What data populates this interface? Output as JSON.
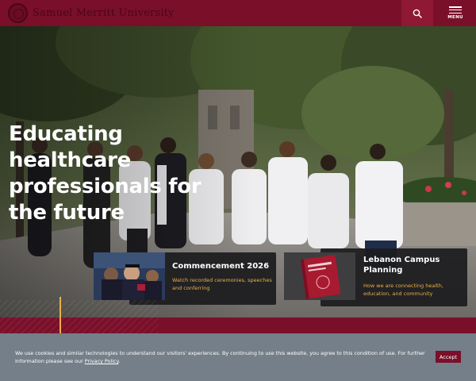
{
  "header": {
    "logo_text": "Samuel Merritt University",
    "search_icon": "search-icon",
    "menu_label": "MENU"
  },
  "hero": {
    "title": "Educating healthcare professionals for the future"
  },
  "cards": [
    {
      "title": "Commencement 2026",
      "link": "Watch recorded ceremonies, speeches and conferring"
    },
    {
      "title": "Lebanon Campus Planning",
      "link": "How we are connecting health, education, and community"
    }
  ],
  "cookie": {
    "text": "We use cookies and similar technologies to understand our visitors' experiences. By continuing to use this website, you agree to this condition of use. For further information please see our",
    "link": "Privacy Policy",
    "suffix": ".",
    "accept_label": "Accept"
  },
  "colors": {
    "brand": "#7a0f2a",
    "accent": "#e8b04a",
    "cookie_bg": "#747f89"
  }
}
